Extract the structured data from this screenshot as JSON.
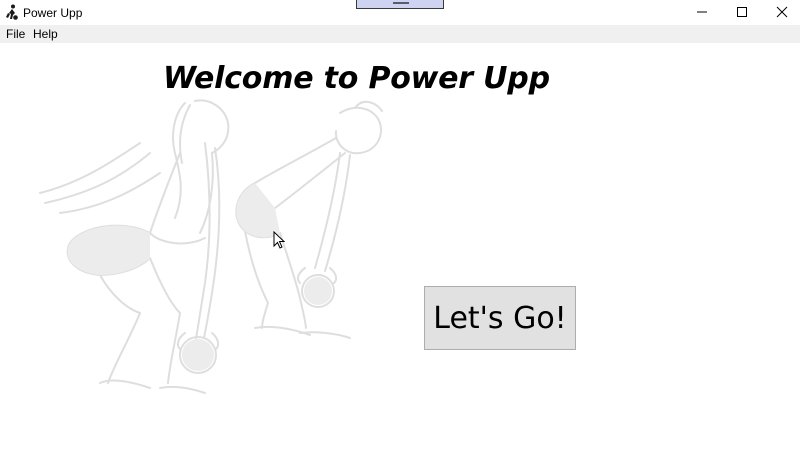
{
  "window": {
    "title": "Power Upp",
    "icon": "kettlebell-lifter-icon",
    "controls": [
      "minimize-icon",
      "maximize-icon",
      "close-icon"
    ]
  },
  "menu": {
    "items": [
      {
        "label": "File"
      },
      {
        "label": "Help"
      }
    ]
  },
  "main": {
    "heading": "Welcome to Power Upp",
    "start_button_label": "Let's Go!",
    "background_art": "kettlebell-swing-sketch",
    "colors": {
      "background": "#ffffff",
      "button_face": "#e1e1e1",
      "button_border": "#adadad",
      "menubar": "#f0f0f0",
      "sketch": "#dcdcdc"
    }
  }
}
